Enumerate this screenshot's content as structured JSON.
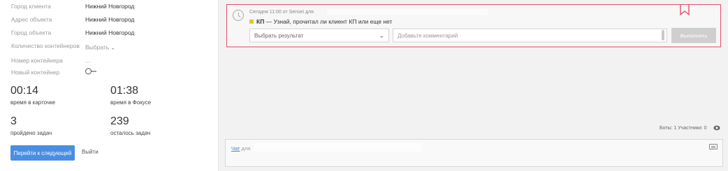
{
  "fields": [
    {
      "label": "Город клиента",
      "value": "Нижний Новгород"
    },
    {
      "label": "Адрес объекта",
      "value": "Нижний Новгород"
    },
    {
      "label": "Город объекта",
      "value": "Нижний Новгород"
    },
    {
      "label": "Количество контейнеров",
      "value": "Выбрать"
    },
    {
      "label": "Номер контейнера",
      "value": "..."
    },
    {
      "label": "Новый контейнер",
      "value": ""
    }
  ],
  "icons": {
    "chevron": "chevron-down-icon",
    "clock": "clock-icon",
    "bookmark": "bookmark-icon",
    "eye": "eye-icon",
    "keyboard": "keyboard-icon"
  },
  "stats": {
    "time_card": {
      "value": "00:14",
      "caption": "время в карточке"
    },
    "time_focus": {
      "value": "01:38",
      "caption": "время в Фокусе"
    },
    "tasks_done": {
      "value": "3",
      "caption": "пройдено задач"
    },
    "tasks_left": {
      "value": "239",
      "caption": "осталось задач"
    }
  },
  "actions": {
    "next_label": "Перейти к следующей",
    "exit_label": "Выйти"
  },
  "task": {
    "meta": "Сегодня 11:00 от Sensei для",
    "tag": "КП",
    "text": " — Узнай, прочитал ли клиент КП или еще нет",
    "result_placeholder": "Выбрать результат",
    "comment_placeholder": "Добавьте комментарий",
    "run_label": "Выполнить"
  },
  "colors": {
    "card_border": "#e0506e",
    "primary": "#4a8ee2",
    "bookmark": "#e0506e"
  },
  "footer": {
    "stats": "Боты: 1   Участники: 0"
  },
  "chat": {
    "link": "Чат",
    "suffix": " для"
  }
}
